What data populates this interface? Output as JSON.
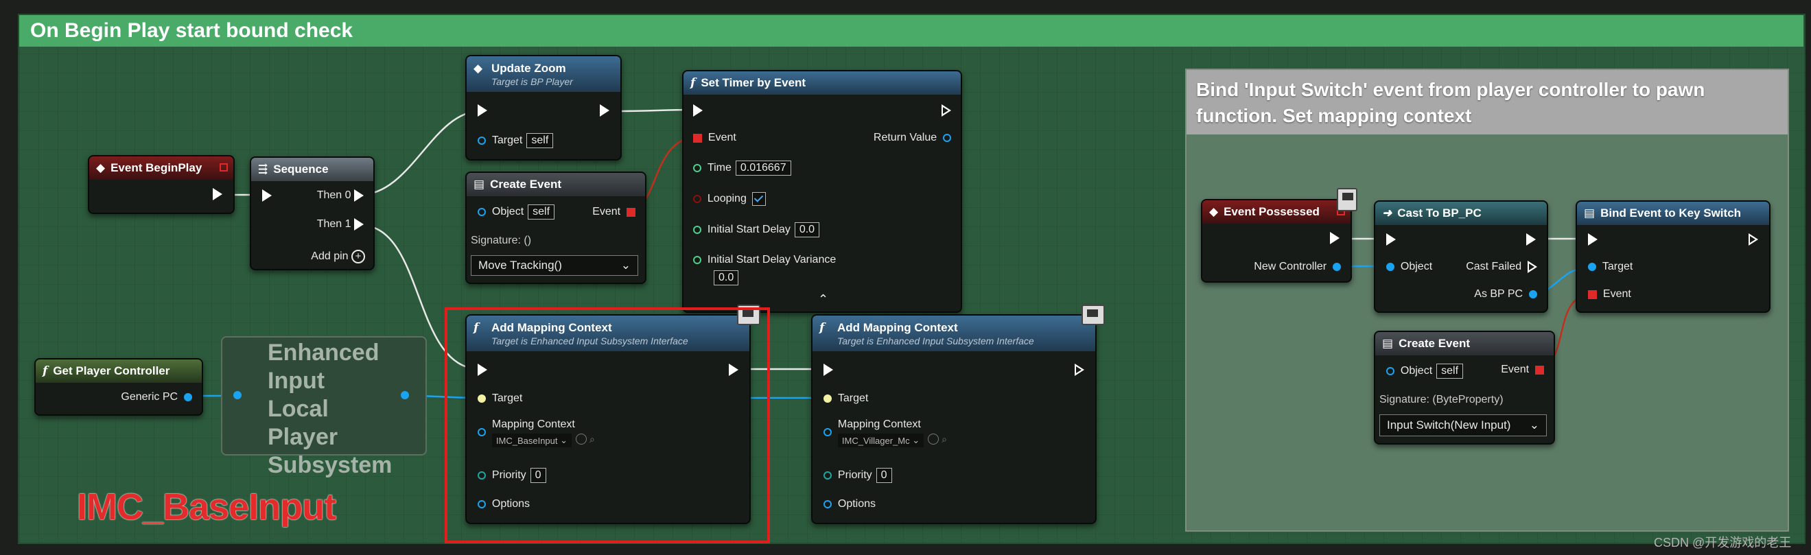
{
  "comments": {
    "main_title": "On Begin Play start bound check",
    "side_title": "Bind 'Input Switch' event from player controller to pawn function. Set mapping context"
  },
  "nodes": {
    "event_begin_play": {
      "title": "Event BeginPlay"
    },
    "sequence": {
      "title": "Sequence",
      "then0": "Then 0",
      "then1": "Then 1",
      "add_pin": "Add pin"
    },
    "update_zoom": {
      "title": "Update Zoom",
      "subtitle": "Target is BP Player",
      "target_label": "Target",
      "target_value": "self"
    },
    "create_event_1": {
      "title": "Create Event",
      "object_label": "Object",
      "object_value": "self",
      "event_label": "Event",
      "signature": "Signature: ()",
      "dropdown_value": "Move Tracking()"
    },
    "set_timer": {
      "title": "Set Timer by Event",
      "event_label": "Event",
      "return_label": "Return Value",
      "time_label": "Time",
      "time_value": "0.016667",
      "looping_label": "Looping",
      "looping_checked": true,
      "isd_label": "Initial Start Delay",
      "isd_value": "0.0",
      "isdv_label": "Initial Start Delay Variance",
      "isdv_value": "0.0"
    },
    "get_player_controller": {
      "title": "Get Player Controller",
      "output_label": "Generic PC"
    },
    "enhanced_input": {
      "label": "Enhanced Input Local Player Subsystem"
    },
    "add_mapping_1": {
      "title": "Add Mapping Context",
      "subtitle": "Target is Enhanced Input Subsystem Interface",
      "target_label": "Target",
      "mc_label": "Mapping Context",
      "mc_value": "IMC_BaseInput",
      "priority_label": "Priority",
      "priority_value": "0",
      "options_label": "Options"
    },
    "add_mapping_2": {
      "title": "Add Mapping Context",
      "subtitle": "Target is Enhanced Input Subsystem Interface",
      "target_label": "Target",
      "mc_label": "Mapping Context",
      "mc_value": "IMC_Villager_Mc",
      "priority_label": "Priority",
      "priority_value": "0",
      "options_label": "Options"
    },
    "event_possessed": {
      "title": "Event Possessed",
      "output_label": "New Controller"
    },
    "cast_to_bp_pc": {
      "title": "Cast To BP_PC",
      "object_label": "Object",
      "cast_failed_label": "Cast Failed",
      "as_label": "As BP PC"
    },
    "bind_event": {
      "title": "Bind Event to Key Switch",
      "target_label": "Target",
      "event_label": "Event"
    },
    "create_event_2": {
      "title": "Create Event",
      "object_label": "Object",
      "object_value": "self",
      "event_label": "Event",
      "signature": "Signature: (ByteProperty)",
      "dropdown_value": "Input Switch(New Input)"
    }
  },
  "annotation": {
    "text": "IMC_BaseInput"
  },
  "watermark": "CSDN @开发游戏的老王",
  "colors": {
    "exec": "#ffffff",
    "object_pin": "#1aa3f0",
    "delegate_pin": "#e02a2a",
    "highlight": "#e31c1c",
    "comment_main": "#4aaa68",
    "comment_side": "#a8a8a8"
  }
}
